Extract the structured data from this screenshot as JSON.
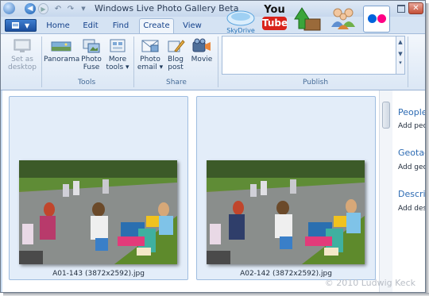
{
  "window": {
    "title": "Windows Live Photo Gallery Beta"
  },
  "quick_access": {
    "back": "◀",
    "forward": "▶",
    "dropdown": "▼"
  },
  "tabs": [
    {
      "label": "Home"
    },
    {
      "label": "Edit"
    },
    {
      "label": "Find"
    },
    {
      "label": "Create",
      "active": true
    },
    {
      "label": "View"
    }
  ],
  "ribbon": {
    "set_as_desktop": {
      "line1": "Set as",
      "line2": "desktop",
      "enabled": false
    },
    "tools": {
      "label": "Tools",
      "buttons": [
        {
          "line1": "Panorama",
          "line2": "",
          "icon": "panorama-icon"
        },
        {
          "line1": "Photo",
          "line2": "Fuse",
          "icon": "photo-fuse-icon"
        },
        {
          "line1": "More",
          "line2": "tools ▾",
          "icon": "more-tools-icon"
        }
      ]
    },
    "share": {
      "label": "Share",
      "buttons": [
        {
          "line1": "Photo",
          "line2": "email ▾",
          "icon": "photo-email-icon"
        },
        {
          "line1": "Blog",
          "line2": "post",
          "icon": "blog-post-icon"
        },
        {
          "line1": "Movie",
          "line2": "",
          "icon": "movie-icon"
        }
      ]
    },
    "publish": {
      "label": "Publish",
      "services": [
        {
          "name": "SkyDrive",
          "icon": "skydrive-icon"
        },
        {
          "name": "You Tube",
          "icon": "youtube-icon"
        },
        {
          "name": "",
          "icon": "upload-arrow-icon"
        },
        {
          "name": "",
          "icon": "groups-icon"
        },
        {
          "name": "",
          "icon": "flickr-icon"
        }
      ]
    }
  },
  "photos": [
    {
      "caption": "A01-143 (3872x2592).jpg"
    },
    {
      "caption": "A02-142 (3872x2592).jpg"
    }
  ],
  "info_pane": {
    "sections": [
      {
        "heading": "People",
        "sub": "Add people"
      },
      {
        "heading": "Geotag",
        "sub": "Add geotag"
      },
      {
        "heading": "Description",
        "sub": "Add description"
      }
    ]
  },
  "watermark": "© 2010 Ludwig Keck",
  "colors": {
    "accent": "#15428b",
    "ribbon_bg": "#dbe7f5",
    "tile_bg": "#e3edf9",
    "link": "#2d6bb3"
  }
}
